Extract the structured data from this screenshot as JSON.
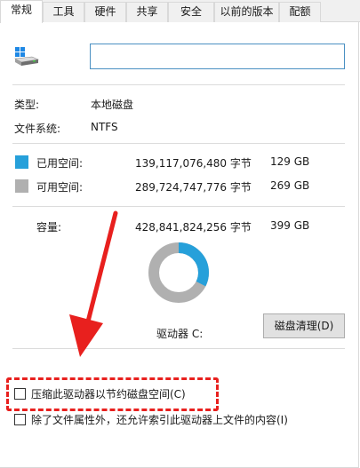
{
  "tabs": [
    "常规",
    "工具",
    "硬件",
    "共享",
    "安全",
    "以前的版本",
    "配额"
  ],
  "active_tab": 0,
  "volume_name_value": "",
  "type": {
    "label": "类型:",
    "value": "本地磁盘"
  },
  "filesystem": {
    "label": "文件系统:",
    "value": "NTFS"
  },
  "used": {
    "label": "已用空间:",
    "bytes": "139,117,076,480 字节",
    "size": "129 GB",
    "color": "#26a0da"
  },
  "free": {
    "label": "可用空间:",
    "bytes": "289,724,747,776 字节",
    "size": "269 GB",
    "color": "#b0b0b0"
  },
  "capacity": {
    "label": "容量:",
    "bytes": "428,841,824,256 字节",
    "size": "399 GB"
  },
  "used_fraction": 0.324,
  "drive_label": "驱动器 C:",
  "cleanup_button": "磁盘清理(D)",
  "checkboxes": [
    {
      "label": "压缩此驱动器以节约磁盘空间(C)",
      "checked": false
    },
    {
      "label": "除了文件属性外，还允许索引此驱动器上文件的内容(I)",
      "checked": false
    }
  ],
  "icons": {
    "drive": "hard-drive-icon",
    "annotation": "red-arrow-annotation"
  }
}
